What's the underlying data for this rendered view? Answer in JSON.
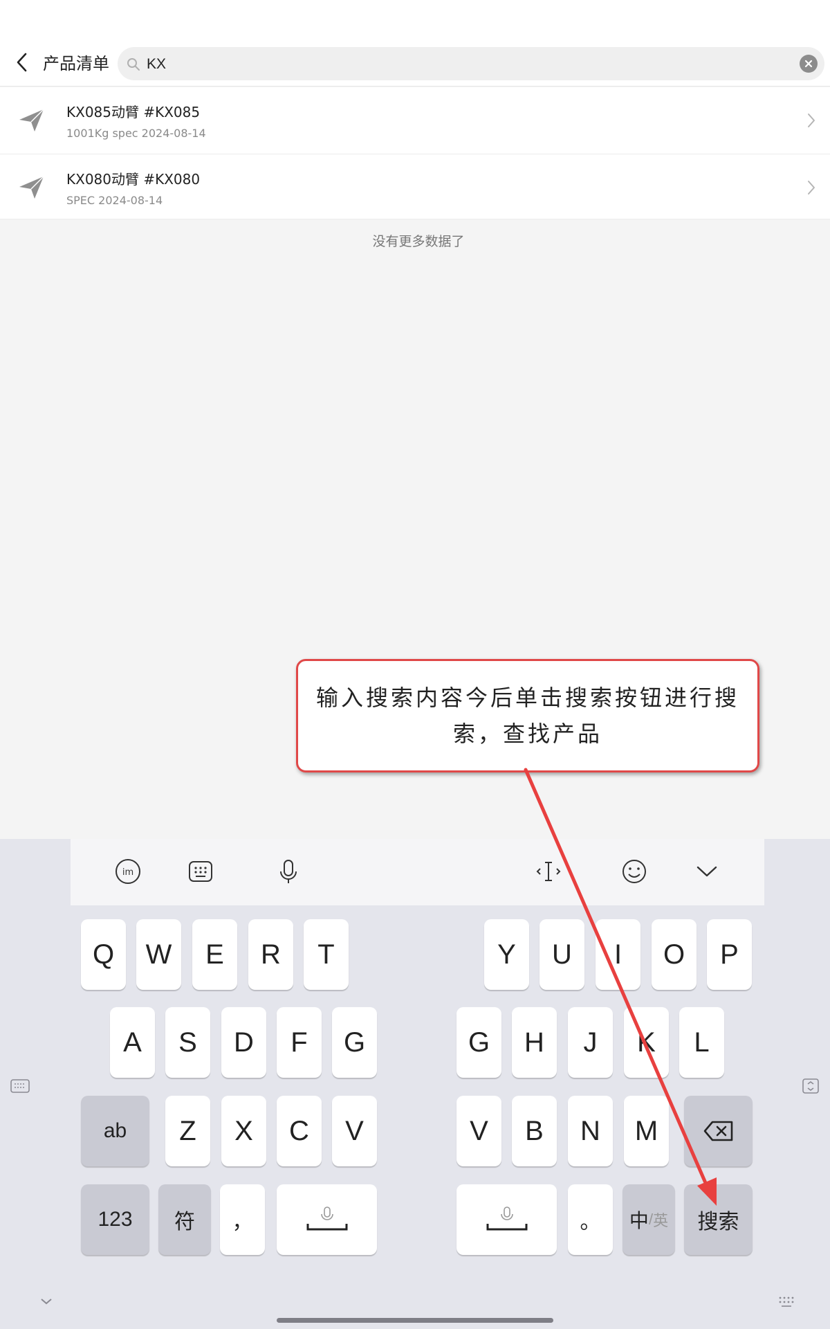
{
  "header": {
    "title": "产品清单",
    "search_value": "KX"
  },
  "products": [
    {
      "title": "KX085动臂 #KX085",
      "subtitle": "1001Kg spec 2024-08-14"
    },
    {
      "title": "KX080动臂 #KX080",
      "subtitle": "SPEC 2024-08-14"
    }
  ],
  "list_footer": "没有更多数据了",
  "annotation": {
    "text": "输入搜索内容今后单击搜索按钮进行搜索，查找产品"
  },
  "keyboard": {
    "row1_left": [
      "Q",
      "W",
      "E",
      "R",
      "T"
    ],
    "row1_right": [
      "Y",
      "U",
      "I",
      "O",
      "P"
    ],
    "row2_left": [
      "A",
      "S",
      "D",
      "F",
      "G"
    ],
    "row2_right": [
      "G",
      "H",
      "J",
      "K",
      "L"
    ],
    "row3_left": [
      "Z",
      "X",
      "C",
      "V"
    ],
    "row3_right": [
      "V",
      "B",
      "N",
      "M"
    ],
    "ab": "ab",
    "num": "123",
    "symbol": "符",
    "comma": "，",
    "period": "。",
    "lang_cn": "中",
    "lang_sep": "/",
    "lang_en": "英",
    "search": "搜索"
  },
  "colors": {
    "annotation_border": "#e04848",
    "arrow": "#e8403f",
    "caret": "#00aaaa",
    "keyboard_bg": "#e4e5ec"
  }
}
